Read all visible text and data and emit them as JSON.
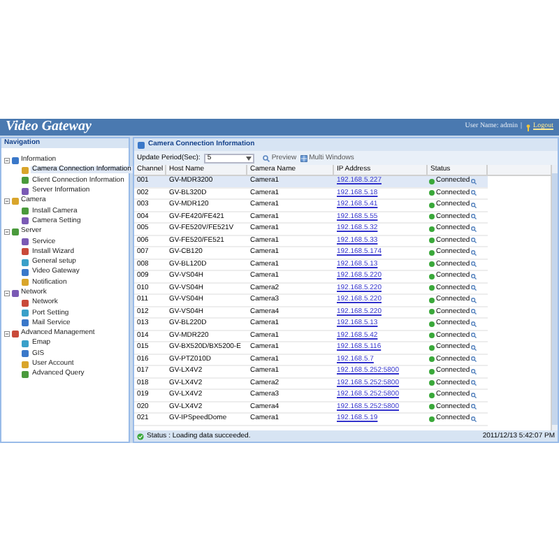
{
  "header": {
    "title": "Video Gateway",
    "user_label": "User Name: admin",
    "separator": "|",
    "logout": "Logout"
  },
  "navigation": {
    "title": "Navigation",
    "groups": [
      {
        "label": "Information",
        "expanded": true,
        "children": [
          {
            "label": "Camera Connection Information",
            "selected": true
          },
          {
            "label": "Client Connection Information",
            "selected": false
          },
          {
            "label": "Server Information",
            "selected": false
          }
        ]
      },
      {
        "label": "Camera",
        "expanded": true,
        "children": [
          {
            "label": "Install Camera",
            "selected": false
          },
          {
            "label": "Camera Setting",
            "selected": false
          }
        ]
      },
      {
        "label": "Server",
        "expanded": true,
        "children": [
          {
            "label": "Service",
            "selected": false
          },
          {
            "label": "Install Wizard",
            "selected": false
          },
          {
            "label": "General setup",
            "selected": false
          },
          {
            "label": "Video Gateway",
            "selected": false
          },
          {
            "label": "Notification",
            "selected": false
          }
        ]
      },
      {
        "label": "Network",
        "expanded": true,
        "children": [
          {
            "label": "Network",
            "selected": false
          },
          {
            "label": "Port Setting",
            "selected": false
          },
          {
            "label": "Mail Service",
            "selected": false
          }
        ]
      },
      {
        "label": "Advanced Management",
        "expanded": true,
        "children": [
          {
            "label": "Emap",
            "selected": false
          },
          {
            "label": "GIS",
            "selected": false
          },
          {
            "label": "User Account",
            "selected": false
          },
          {
            "label": "Advanced Query",
            "selected": false
          }
        ]
      }
    ]
  },
  "panel": {
    "title": "Camera Connection Information",
    "update_label": "Update Period(Sec):",
    "update_value": "5",
    "preview": "Preview",
    "multi_windows": "Multi Windows"
  },
  "table": {
    "columns": [
      "Channel",
      "Host Name",
      "Camera Name",
      "IP Address",
      "Status"
    ],
    "rows": [
      {
        "channel": "001",
        "host": "GV-MDR3200",
        "camera": "Camera1",
        "ip": "192.168.5.227",
        "status": "Connected",
        "selected": true
      },
      {
        "channel": "002",
        "host": "GV-BL320D",
        "camera": "Camera1",
        "ip": "192.168.5.18",
        "status": "Connected",
        "selected": false
      },
      {
        "channel": "003",
        "host": "GV-MDR120",
        "camera": "Camera1",
        "ip": "192.168.5.41",
        "status": "Connected",
        "selected": false
      },
      {
        "channel": "004",
        "host": "GV-FE420/FE421",
        "camera": "Camera1",
        "ip": "192.168.5.55",
        "status": "Connected",
        "selected": false
      },
      {
        "channel": "005",
        "host": "GV-FE520V/FE521V",
        "camera": "Camera1",
        "ip": "192.168.5.32",
        "status": "Connected",
        "selected": false
      },
      {
        "channel": "006",
        "host": "GV-FE520/FE521",
        "camera": "Camera1",
        "ip": "192.168.5.33",
        "status": "Connected",
        "selected": false
      },
      {
        "channel": "007",
        "host": "GV-CB120",
        "camera": "Camera1",
        "ip": "192.168.5.174",
        "status": "Connected",
        "selected": false
      },
      {
        "channel": "008",
        "host": "GV-BL120D",
        "camera": "Camera1",
        "ip": "192.168.5.13",
        "status": "Connected",
        "selected": false
      },
      {
        "channel": "009",
        "host": "GV-VS04H",
        "camera": "Camera1",
        "ip": "192.168.5.220",
        "status": "Connected",
        "selected": false
      },
      {
        "channel": "010",
        "host": "GV-VS04H",
        "camera": "Camera2",
        "ip": "192.168.5.220",
        "status": "Connected",
        "selected": false
      },
      {
        "channel": "011",
        "host": "GV-VS04H",
        "camera": "Camera3",
        "ip": "192.168.5.220",
        "status": "Connected",
        "selected": false
      },
      {
        "channel": "012",
        "host": "GV-VS04H",
        "camera": "Camera4",
        "ip": "192.168.5.220",
        "status": "Connected",
        "selected": false
      },
      {
        "channel": "013",
        "host": "GV-BL220D",
        "camera": "Camera1",
        "ip": "192.168.5.13",
        "status": "Connected",
        "selected": false
      },
      {
        "channel": "014",
        "host": "GV-MDR220",
        "camera": "Camera1",
        "ip": "192.168.5.42",
        "status": "Connected",
        "selected": false
      },
      {
        "channel": "015",
        "host": "GV-BX520D/BX5200-E",
        "camera": "Camera1",
        "ip": "192.168.5.116",
        "status": "Connected",
        "selected": false
      },
      {
        "channel": "016",
        "host": "GV-PTZ010D",
        "camera": "Camera1",
        "ip": "192.168.5.7",
        "status": "Connected",
        "selected": false
      },
      {
        "channel": "017",
        "host": "GV-LX4V2",
        "camera": "Camera1",
        "ip": "192.168.5.252:5800",
        "status": "Connected",
        "selected": false
      },
      {
        "channel": "018",
        "host": "GV-LX4V2",
        "camera": "Camera2",
        "ip": "192.168.5.252:5800",
        "status": "Connected",
        "selected": false
      },
      {
        "channel": "019",
        "host": "GV-LX4V2",
        "camera": "Camera3",
        "ip": "192.168.5.252:5800",
        "status": "Connected",
        "selected": false
      },
      {
        "channel": "020",
        "host": "GV-LX4V2",
        "camera": "Camera4",
        "ip": "192.168.5.252:5800",
        "status": "Connected",
        "selected": false
      },
      {
        "channel": "021",
        "host": "GV-IPSpeedDome",
        "camera": "Camera1",
        "ip": "192.168.5.19",
        "status": "Connected",
        "selected": false
      }
    ]
  },
  "status_bar": {
    "message": "Status : Loading data succeeded.",
    "time": "2011/12/13 5:42:07 PM"
  }
}
